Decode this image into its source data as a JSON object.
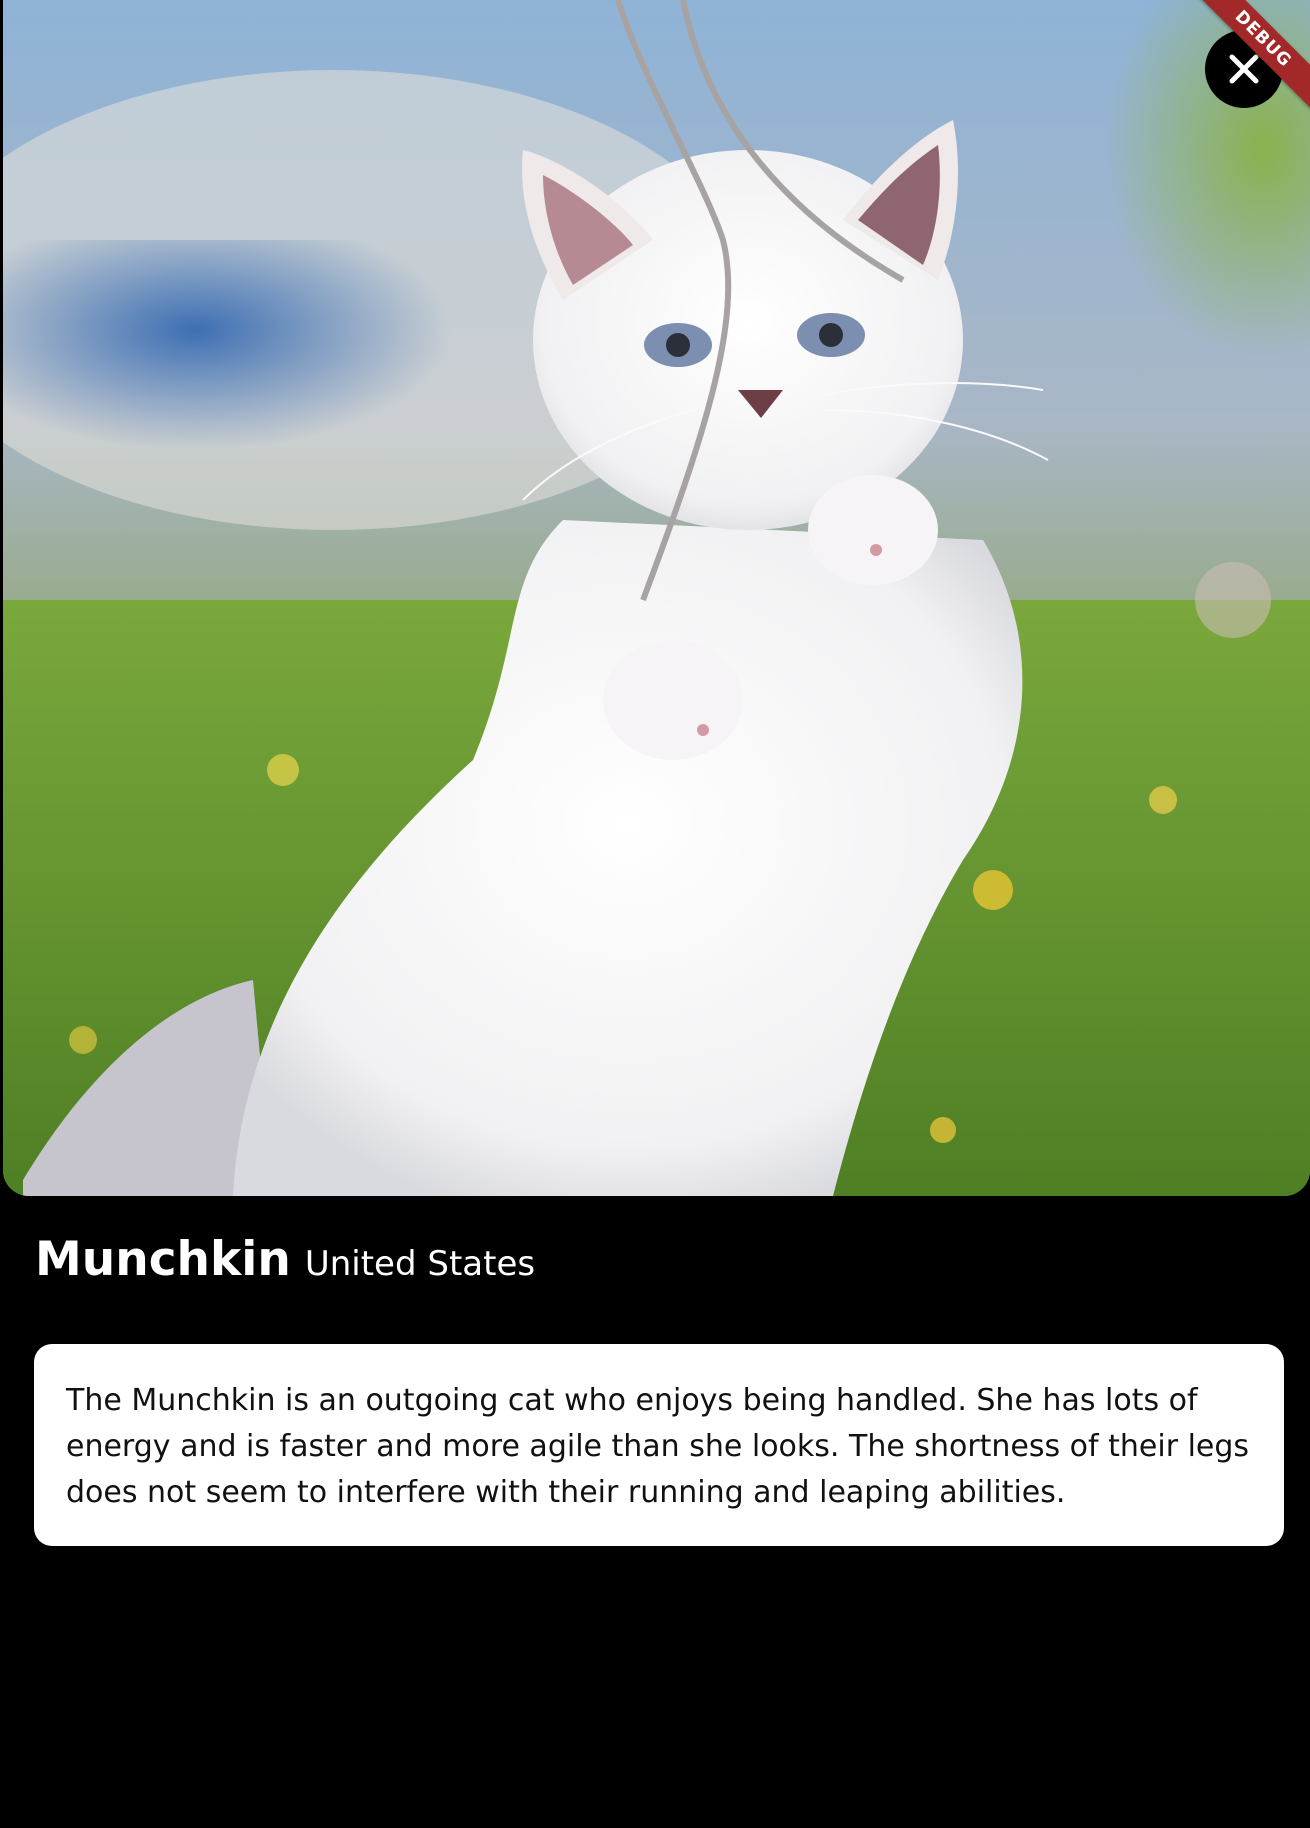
{
  "breed": {
    "name": "Munchkin",
    "origin": "United States",
    "description": "The Munchkin is an outgoing cat who enjoys being handled. She has lots of energy and is faster and more agile than she looks. The shortness of their legs does not seem to interfere with their running and leaping abilities."
  },
  "close_button": {
    "icon": "close-icon"
  },
  "debug_banner": {
    "label": "DEBUG"
  },
  "colors": {
    "background": "#000000",
    "card": "#ffffff",
    "banner": "#a2282a",
    "text_primary": "#ffffff",
    "text_card": "#111111"
  }
}
